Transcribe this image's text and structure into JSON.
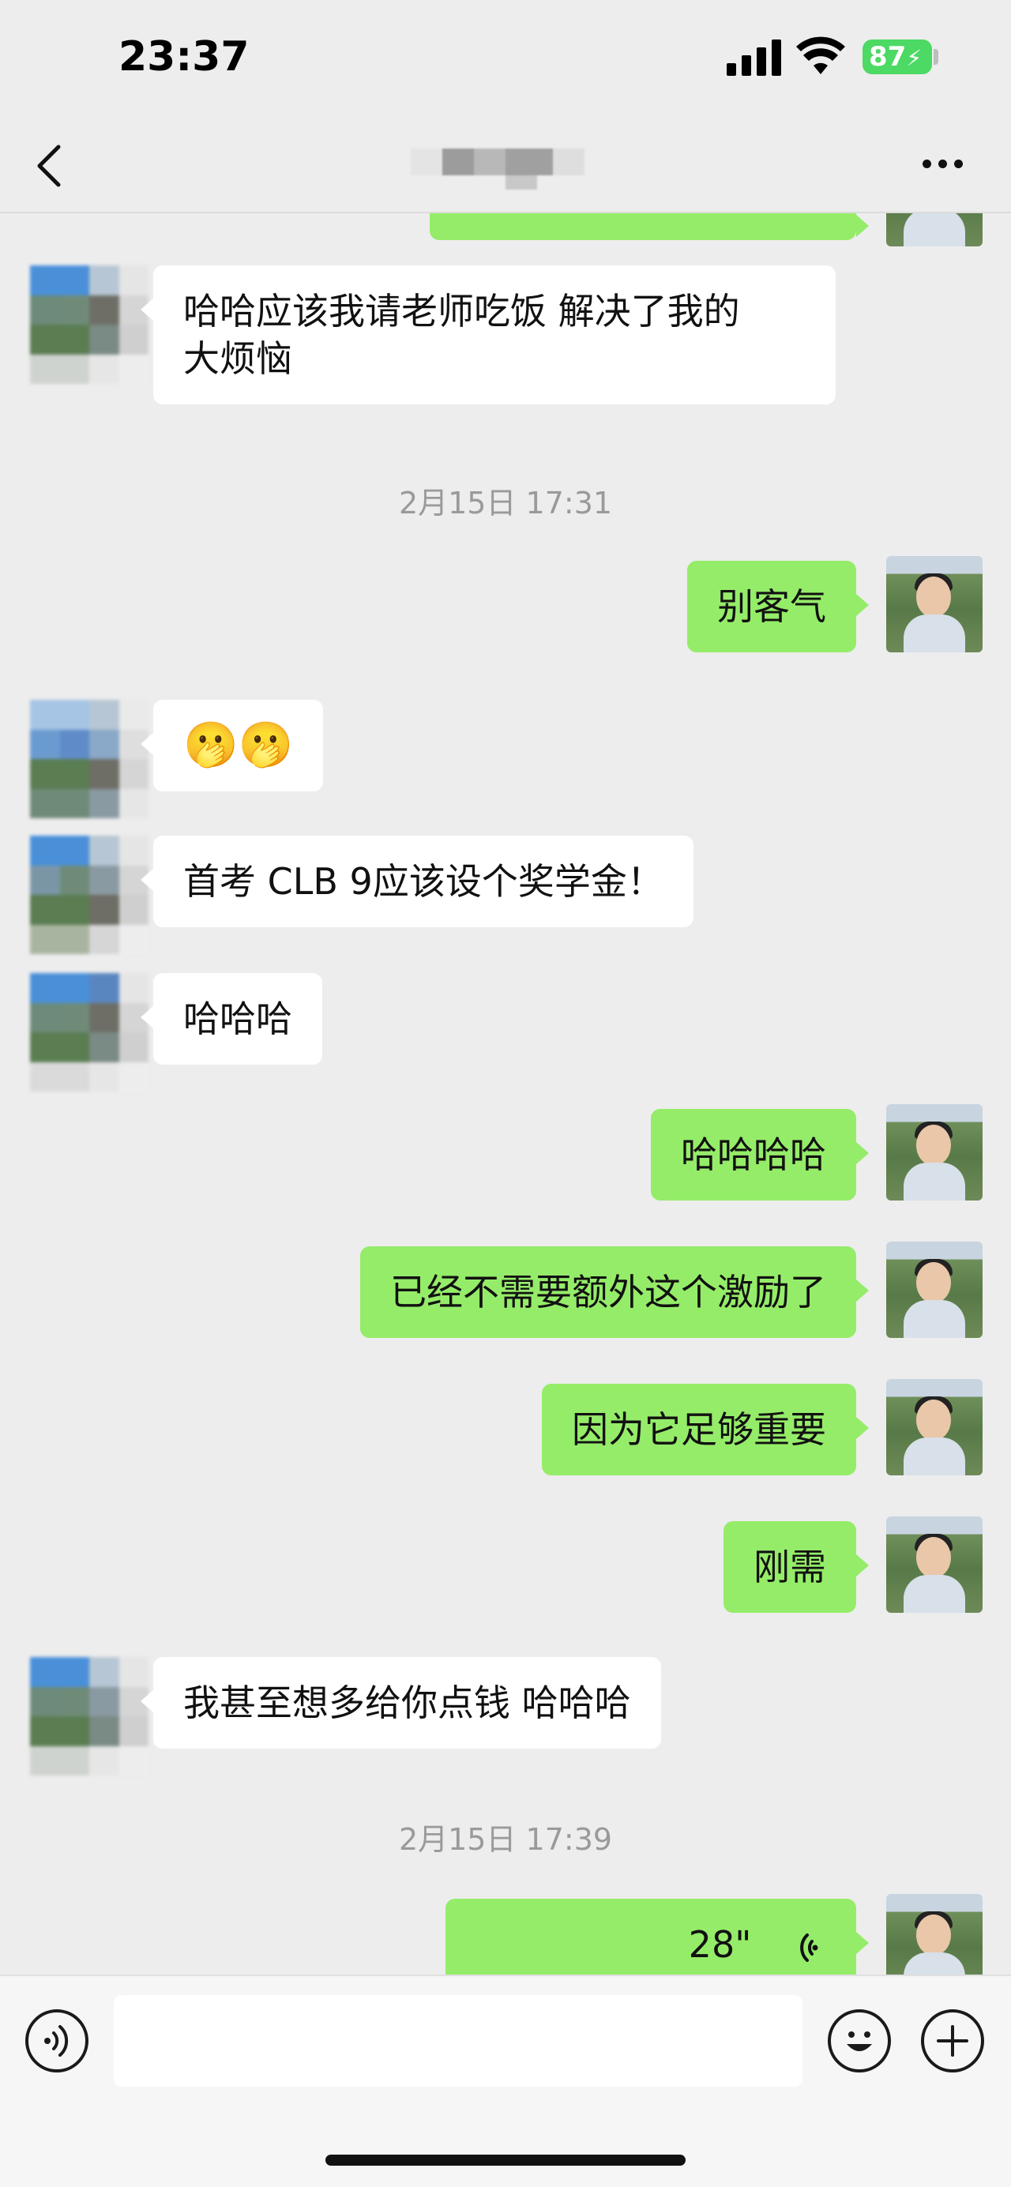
{
  "status_bar": {
    "time": "23:37",
    "battery": "87"
  },
  "messages": [
    {
      "side": "left",
      "text_lines": [
        "哈哈应该我请老师吃饭 解决了我的",
        "大烦恼"
      ]
    },
    {
      "timestamp": "2月15日 17:31"
    },
    {
      "side": "right",
      "text": "别客气"
    },
    {
      "side": "left",
      "text": "🫢🫢"
    },
    {
      "side": "left",
      "text": "首考 CLB 9应该设个奖学金！"
    },
    {
      "side": "left",
      "text": "哈哈哈"
    },
    {
      "side": "right",
      "text": "哈哈哈哈"
    },
    {
      "side": "right",
      "text": "已经不需要额外这个激励了"
    },
    {
      "side": "right",
      "text": "因为它足够重要"
    },
    {
      "side": "right",
      "text": "刚需"
    },
    {
      "side": "left",
      "text": "我甚至想多给你点钱 哈哈哈"
    },
    {
      "timestamp": "2月15日 17:39"
    },
    {
      "side": "right",
      "voice_duration": "28\""
    }
  ],
  "icons": {
    "back": "chevron-left-icon",
    "more": "more-dots-icon",
    "voice_input": "voice-input-icon",
    "emoji": "emoji-icon",
    "plus": "plus-icon",
    "voice_wave": "voice-wave-icon"
  },
  "colors": {
    "sent_bubble": "#95ec69",
    "received_bubble": "#ffffff",
    "background": "#ededed",
    "timestamp": "#9a9a9a"
  }
}
